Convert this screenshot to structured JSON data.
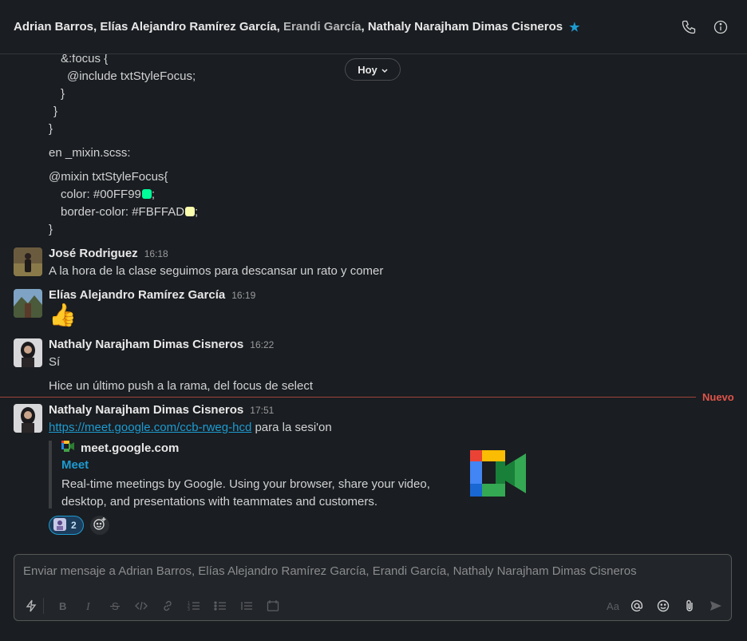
{
  "header": {
    "names": [
      {
        "text": "Adrian Barros",
        "dim": false
      },
      {
        "text": "Elías Alejandro Ramírez García",
        "dim": false
      },
      {
        "text": "Erandi García",
        "dim": true
      },
      {
        "text": "Nathaly Narajham Dimas Cisneros",
        "dim": false
      }
    ],
    "separator": ", ",
    "star_icon": "star-icon",
    "call_icon": "phone-icon",
    "info_icon": "info-icon"
  },
  "date_pill": {
    "label": "Hoy"
  },
  "code_lines": [
    "&:focus {",
    "@include txtStyleFocus;",
    "}",
    "}",
    "}",
    "en _mixin.scss:",
    "@mixin txtStyleFocus{",
    "color: #00FF99",
    "border-color: #FBFFAD",
    "}"
  ],
  "swatch_suffix": ";",
  "swatch_colors": {
    "green": "#00FF99",
    "yellow": "#FBFFAD"
  },
  "messages": [
    {
      "name": "José Rodriguez",
      "time": "16:18",
      "text": "A la hora de la clase seguimos para descansar un rato y comer"
    },
    {
      "name": "Elías Alejandro Ramírez García",
      "time": "16:19",
      "emoji": "👍"
    },
    {
      "name": "Nathaly Narajham Dimas Cisneros",
      "time": "16:22",
      "text": "Sí",
      "text2": "Hice un último push a la rama, del focus de select"
    },
    {
      "name": "Nathaly Narajham Dimas Cisneros",
      "time": "17:51",
      "link": "https://meet.google.com/ccb-rweg-hcd",
      "text_after": " para la sesi'on"
    }
  ],
  "new_divider": {
    "label": "Nuevo"
  },
  "unfurl": {
    "site": "meet.google.com",
    "title": "Meet",
    "description": "Real-time meetings by Google. Using your browser, share your video, desktop, and presentations with teammates and customers."
  },
  "reactions": [
    {
      "count": "2"
    }
  ],
  "composer": {
    "placeholder": "Enviar mensaje a Adrian Barros, Elías Alejandro Ramírez García, Erandi García, Nathaly Narajham Dimas Cisneros",
    "format_label": "Aa"
  },
  "colors": {
    "accent": "#1d9bd1",
    "new_divider": "#e0544a",
    "background": "#1a1d21"
  }
}
